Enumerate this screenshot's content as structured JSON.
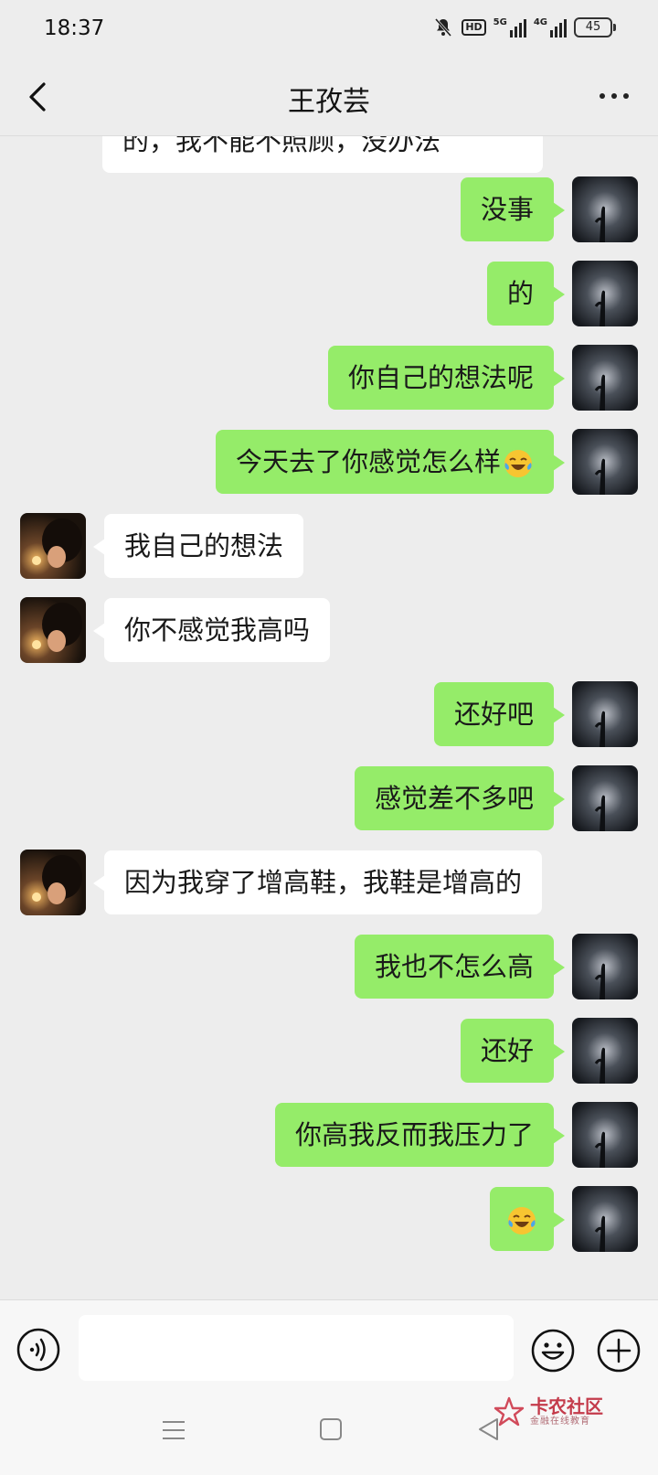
{
  "status": {
    "time": "18:37",
    "hd": "HD",
    "net1": "5G",
    "net2": "4G",
    "battery": "45"
  },
  "header": {
    "title": "王孜芸"
  },
  "messages": [
    {
      "side": "in",
      "text": "的，我不能不照顾，没办法",
      "partial": true
    },
    {
      "side": "out",
      "text": "没事"
    },
    {
      "side": "out",
      "text": "的"
    },
    {
      "side": "out",
      "text": "你自己的想法呢"
    },
    {
      "side": "out",
      "text": "今天去了你感觉怎么样",
      "emoji": "crying-laugh"
    },
    {
      "side": "in",
      "text": "我自己的想法"
    },
    {
      "side": "in",
      "text": "你不感觉我高吗"
    },
    {
      "side": "out",
      "text": "还好吧"
    },
    {
      "side": "out",
      "text": "感觉差不多吧"
    },
    {
      "side": "in",
      "text": "因为我穿了增高鞋，我鞋是增高的"
    },
    {
      "side": "out",
      "text": "我也不怎么高"
    },
    {
      "side": "out",
      "text": "还好"
    },
    {
      "side": "out",
      "text": "你高我反而我压力了"
    },
    {
      "side": "out",
      "text": "",
      "emoji": "crying-laugh"
    }
  ],
  "watermark": {
    "title": "卡农社区",
    "subtitle": "金融在线教育"
  },
  "icons": [
    "back-arrow-icon",
    "more-dots-icon",
    "voice-icon",
    "emoji-icon",
    "plus-icon",
    "mute-bell-icon"
  ]
}
